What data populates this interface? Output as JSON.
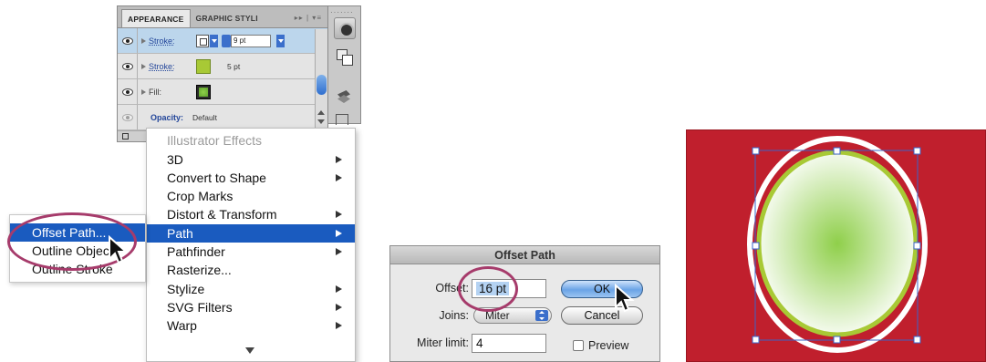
{
  "appearance_panel": {
    "tabs": [
      "APPEARANCE",
      "GRAPHIC STYLI"
    ],
    "menu_glyphs": "▸▸ | ▾≡",
    "rows": [
      {
        "label": "Stroke:",
        "value": "9 pt",
        "type": "stroke-none"
      },
      {
        "label": "Stroke:",
        "value": "5 pt",
        "type": "stroke-green"
      },
      {
        "label": "Fill:",
        "type": "fill-gradient"
      },
      {
        "label": "Opacity:",
        "value": "Default",
        "type": "opacity"
      }
    ]
  },
  "effects_menu": {
    "heading": "Illustrator Effects",
    "items": [
      {
        "label": "3D",
        "submenu": true
      },
      {
        "label": "Convert to Shape",
        "submenu": true
      },
      {
        "label": "Crop Marks",
        "submenu": false
      },
      {
        "label": "Distort & Transform",
        "submenu": true
      },
      {
        "label": "Path",
        "submenu": true,
        "active": true
      },
      {
        "label": "Pathfinder",
        "submenu": true
      },
      {
        "label": "Rasterize...",
        "submenu": false
      },
      {
        "label": "Stylize",
        "submenu": true
      },
      {
        "label": "SVG Filters",
        "submenu": true
      },
      {
        "label": "Warp",
        "submenu": true
      }
    ]
  },
  "path_submenu": {
    "items": [
      {
        "label": "Offset Path...",
        "active": true
      },
      {
        "label": "Outline Object"
      },
      {
        "label": "Outline Stroke"
      }
    ]
  },
  "offset_dialog": {
    "title": "Offset Path",
    "offset_label": "Offset:",
    "offset_value": "16 pt",
    "joins_label": "Joins:",
    "joins_value": "Miter",
    "miter_label": "Miter limit:",
    "miter_value": "4",
    "ok_label": "OK",
    "cancel_label": "Cancel",
    "preview_label": "Preview",
    "preview_checked": false
  },
  "artwork": {
    "background_color": "#c01f2d",
    "outer_stroke_color": "#ffffff",
    "inner_stroke_color": "#a8c935",
    "fill_center_color": "#8fcf4a",
    "selection_color": "#3a63c8"
  }
}
